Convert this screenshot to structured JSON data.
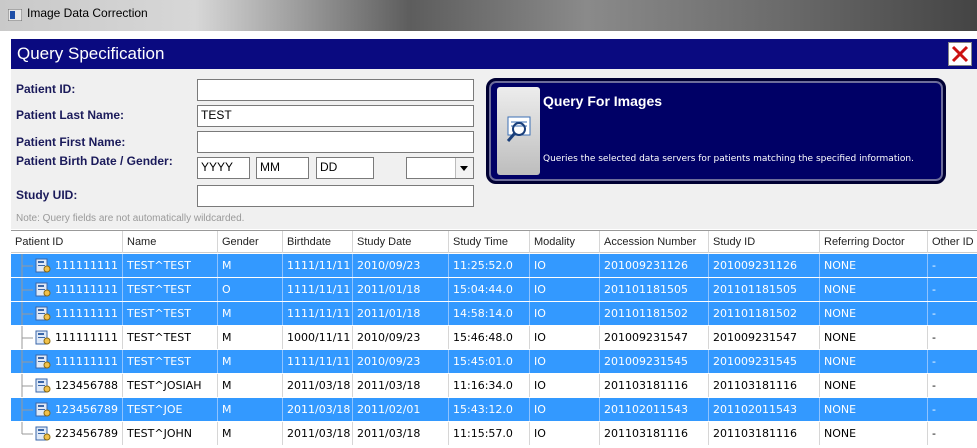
{
  "window": {
    "title": "Image Data Correction"
  },
  "panel": {
    "title": "Query Specification"
  },
  "form": {
    "patient_id_label": "Patient ID:",
    "patient_id_value": "",
    "last_name_label": "Patient Last Name:",
    "last_name_value": "TEST",
    "first_name_label": "Patient First Name:",
    "first_name_value": "",
    "birth_gender_label": "Patient Birth Date / Gender:",
    "year_value": "YYYY",
    "month_value": "MM",
    "day_value": "DD",
    "gender_value": "",
    "study_uid_label": "Study UID:",
    "study_uid_value": "",
    "note": "Note: Query fields are not automatically wildcarded."
  },
  "query_button": {
    "title": "Query For Images",
    "description": "Queries the selected data servers for patients matching the specified information."
  },
  "grid": {
    "columns": [
      "Patient ID",
      "Name",
      "Gender",
      "Birthdate",
      "Study Date",
      "Study Time",
      "Modality",
      "Accession Number",
      "Study ID",
      "Referring Doctor",
      "Other ID"
    ],
    "rows": [
      {
        "selected": true,
        "cells": [
          "111111111",
          "TEST^TEST",
          "M",
          "1111/11/11",
          "2010/09/23",
          "11:25:52.0",
          "IO",
          "201009231126",
          "201009231126",
          "NONE",
          "-"
        ]
      },
      {
        "selected": true,
        "cells": [
          "111111111",
          "TEST^TEST",
          "O",
          "1111/11/11",
          "2011/01/18",
          "15:04:44.0",
          "IO",
          "201101181505",
          "201101181505",
          "NONE",
          "-"
        ]
      },
      {
        "selected": true,
        "cells": [
          "111111111",
          "TEST^TEST",
          "M",
          "1111/11/11",
          "2011/01/18",
          "14:58:14.0",
          "IO",
          "201101181502",
          "201101181502",
          "NONE",
          "-"
        ]
      },
      {
        "selected": false,
        "cells": [
          "111111111",
          "TEST^TEST",
          "M",
          "1000/11/11",
          "2010/09/23",
          "15:46:48.0",
          "IO",
          "201009231547",
          "201009231547",
          "NONE",
          "-"
        ]
      },
      {
        "selected": true,
        "cells": [
          "111111111",
          "TEST^TEST",
          "M",
          "1111/11/11",
          "2010/09/23",
          "15:45:01.0",
          "IO",
          "201009231545",
          "201009231545",
          "NONE",
          "-"
        ]
      },
      {
        "selected": false,
        "cells": [
          "123456788",
          "TEST^JOSIAH",
          "M",
          "2011/03/18",
          "2011/03/18",
          "11:16:34.0",
          "IO",
          "201103181116",
          "201103181116",
          "NONE",
          "-"
        ]
      },
      {
        "selected": true,
        "cells": [
          "123456789",
          "TEST^JOE",
          "M",
          "2011/03/18",
          "2011/02/01",
          "15:43:12.0",
          "IO",
          "201102011543",
          "201102011543",
          "NONE",
          "-"
        ]
      },
      {
        "selected": false,
        "cells": [
          "223456789",
          "TEST^JOHN",
          "M",
          "2011/03/18",
          "2011/03/18",
          "11:15:57.0",
          "IO",
          "201103181116",
          "201103181116",
          "NONE",
          "-"
        ]
      }
    ]
  },
  "colors": {
    "header_bg": "#0a0a80",
    "selection": "#3399ff",
    "button_bg": "#000066"
  },
  "icons": {
    "close": "close-x-icon",
    "query": "magnifier-document-icon",
    "row": "patient-record-icon"
  }
}
